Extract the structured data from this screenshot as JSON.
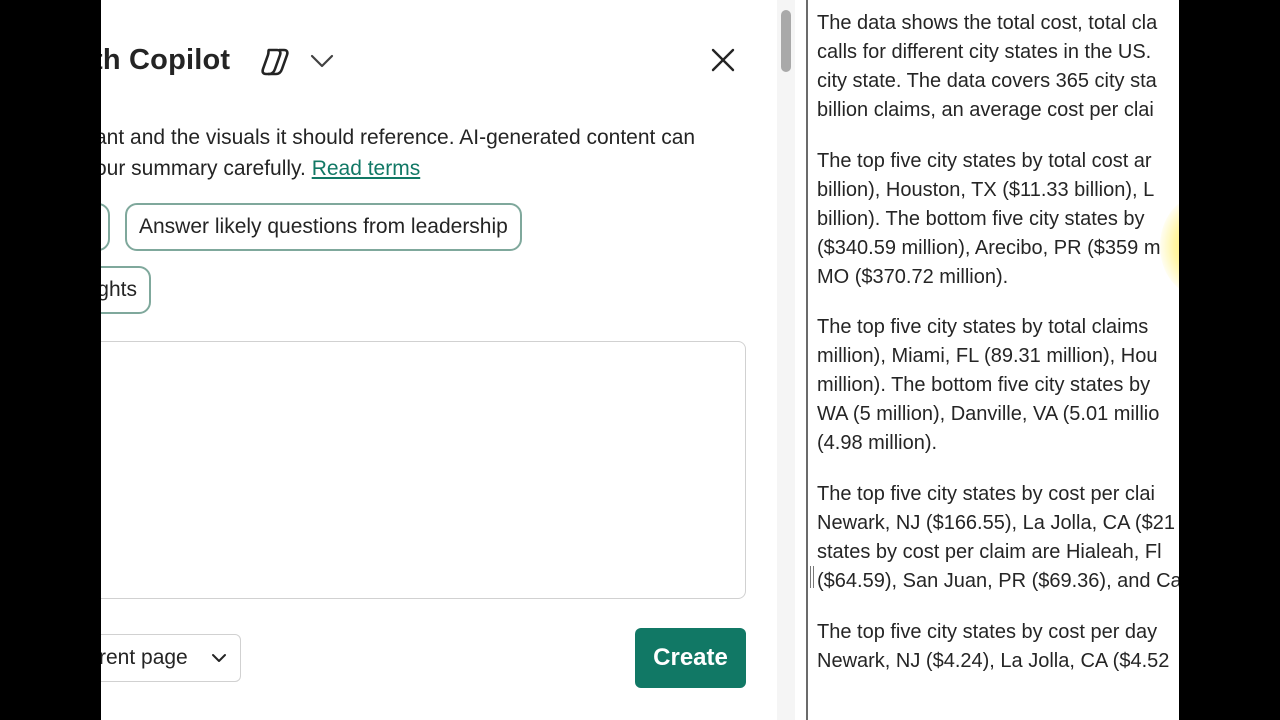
{
  "dialog": {
    "title": "th Copilot",
    "close_icon": "close-icon",
    "copilot_icon": "copilot-logo-icon",
    "description_line1": "ant and the visuals it should reference. AI-generated content can",
    "description_line2_prefix": "our summary carefully.",
    "read_terms_label": "Read terms",
    "chips": [
      {
        "label": ""
      },
      {
        "label": "Answer likely questions from leadership"
      },
      {
        "label": "ghts"
      }
    ],
    "prompt_value": "",
    "page_select_value": "rrent page",
    "create_label": "Create",
    "accent_color": "#117865"
  },
  "summary": {
    "paragraphs": [
      [
        "The data shows the total cost, total cla",
        "calls for different city states in the US.",
        "city state. The data covers 365 city sta",
        "billion claims, an average cost per clai"
      ],
      [
        "The top five city states by total cost ar",
        "billion), Houston, TX ($11.33 billion), L",
        "billion). The bottom five city states by",
        "($340.59 million), Arecibo, PR ($359 m",
        "MO ($370.72 million)."
      ],
      [
        "The top five city states by total claims",
        "million), Miami, FL (89.31 million), Hou",
        "million). The bottom five city states by",
        "WA (5 million), Danville, VA (5.01 millio",
        "(4.98 million)."
      ],
      [
        "The top five city states by cost per clai",
        "Newark, NJ ($166.55), La Jolla, CA ($21",
        "states by cost per claim are Hialeah, Fl",
        "($64.59), San Juan, PR ($69.36), and Ca"
      ],
      [
        "The top five city states by cost per day",
        "Newark, NJ ($4.24), La Jolla, CA ($4.52"
      ]
    ]
  }
}
